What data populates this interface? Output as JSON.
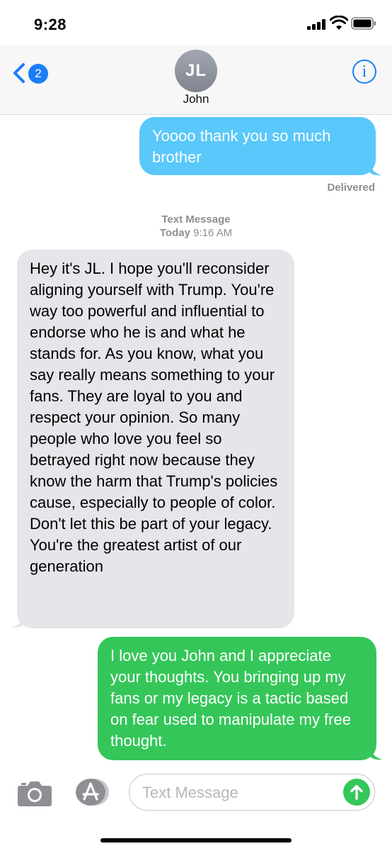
{
  "status_bar": {
    "time": "9:28"
  },
  "header": {
    "back_badge": "2",
    "avatar_initials": "JL",
    "contact_name": "John",
    "info_label": "i"
  },
  "messages": [
    {
      "type": "sent",
      "color": "#5ac8fa",
      "text": "Yoooo thank you so much brother"
    },
    {
      "type": "received",
      "color": "#e5e5ea",
      "text": "Hey it's JL. I hope you'll reconsider aligning yourself with Trump. You're way too powerful and influential to endorse who he is and what he stands for. As you know, what you say really means something to your fans.  They are loyal to you and respect your opinion.  So many people who love you feel so betrayed right now because they know the harm that Trump's policies cause, especially to people of color. Don't let this be part of your legacy. You're the greatest artist of our generation"
    },
    {
      "type": "sent",
      "color": "#35c659",
      "text": "I love you John and I appreciate your thoughts.  You bringing up my fans or my legacy is a tactic based on fear used to manipulate my free thought."
    }
  ],
  "delivered_label": "Delivered",
  "timestamp": {
    "title": "Text Message",
    "day": "Today",
    "time": "9:16 AM"
  },
  "composer": {
    "placeholder": "Text Message",
    "value": ""
  },
  "icons": [
    "back-chevron-icon",
    "info-icon",
    "camera-icon",
    "app-store-icon",
    "send-arrow-icon",
    "signal-icon",
    "wifi-icon",
    "battery-icon"
  ]
}
